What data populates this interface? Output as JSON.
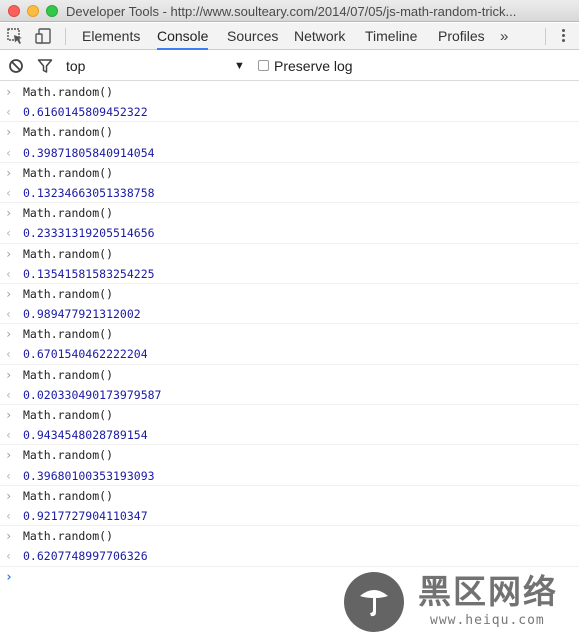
{
  "window": {
    "title": "Developer Tools - http://www.soulteary.com/2014/07/05/js-math-random-trick..."
  },
  "toolbar": {
    "tabs": [
      {
        "label": "Elements",
        "active": false
      },
      {
        "label": "Console",
        "active": true
      },
      {
        "label": "Sources",
        "active": false
      },
      {
        "label": "Network",
        "active": false
      },
      {
        "label": "Timeline",
        "active": false
      },
      {
        "label": "Profiles",
        "active": false
      }
    ],
    "more_label": "»",
    "icons": [
      "inspect-element-icon",
      "device-mode-icon",
      "more-tabs-icon",
      "menu-kebab-icon"
    ]
  },
  "filterbar": {
    "context": "top",
    "preserve_log_label": "Preserve log",
    "preserve_log_checked": false
  },
  "console": {
    "entries": [
      {
        "input": "Math.random()",
        "result": "0.6160145809452322"
      },
      {
        "input": "Math.random()",
        "result": "0.39871805840914054"
      },
      {
        "input": "Math.random()",
        "result": "0.13234663051338758"
      },
      {
        "input": "Math.random()",
        "result": "0.23331319205514656"
      },
      {
        "input": "Math.random()",
        "result": "0.13541581583254225"
      },
      {
        "input": "Math.random()",
        "result": "0.989477921312002"
      },
      {
        "input": "Math.random()",
        "result": "0.6701540462222204"
      },
      {
        "input": "Math.random()",
        "result": "0.020330490173979587"
      },
      {
        "input": "Math.random()",
        "result": "0.9434548028789154"
      },
      {
        "input": "Math.random()",
        "result": "0.39680100353193093"
      },
      {
        "input": "Math.random()",
        "result": "0.9217727904110347"
      },
      {
        "input": "Math.random()",
        "result": "0.6207748997706326"
      }
    ],
    "input_arrow": "›",
    "result_arrow": "‹",
    "prompt_caret": "›"
  },
  "watermark": {
    "text": "黑区网络",
    "url": "www.heiqu.com"
  },
  "colors": {
    "accent": "#3d7ff3",
    "result_text": "#1a1aa6",
    "prompt_caret": "#2f7ae6"
  }
}
